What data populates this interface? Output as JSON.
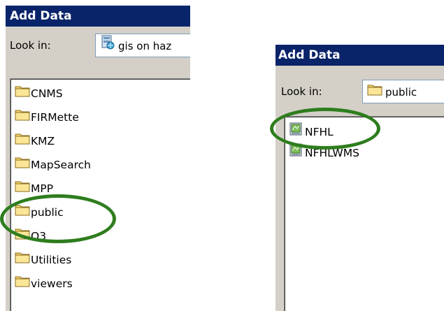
{
  "left_dialog": {
    "title": "Add Data",
    "look_in_label": "Look in:",
    "look_in_value": "gis on haz",
    "folders": [
      "CNMS",
      "FIRMette",
      "KMZ",
      "MapSearch",
      "MPP",
      "public",
      "Q3",
      "Utilities",
      "viewers"
    ]
  },
  "right_dialog": {
    "title": "Add Data",
    "look_in_label": "Look in:",
    "look_in_value": "public",
    "services": [
      "NFHL",
      "NFHLWMS"
    ]
  },
  "colors": {
    "titlebar": "#0a246a",
    "dialog_bg": "#d4d0c8",
    "highlight_circle": "#2e7d1e",
    "folder": "#f5d36b"
  }
}
